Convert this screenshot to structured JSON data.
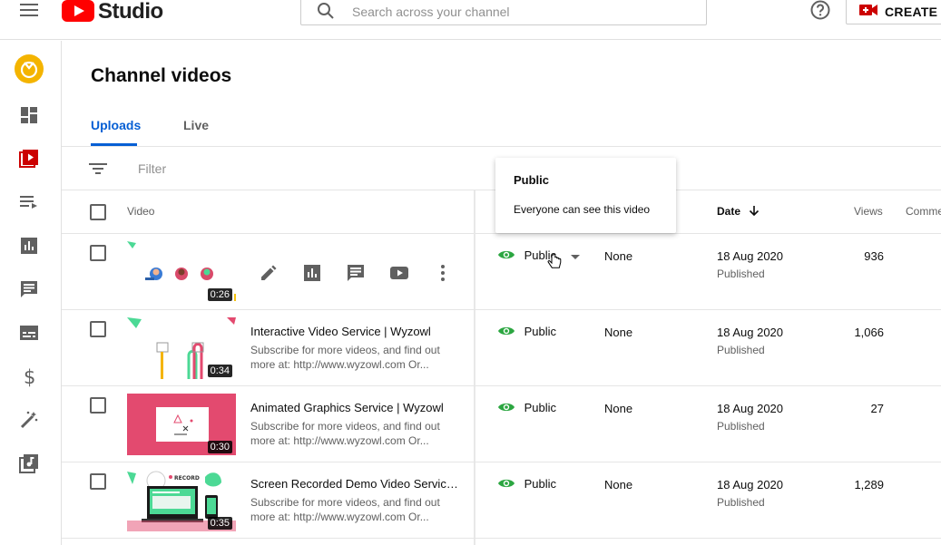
{
  "app": {
    "brand": "Studio"
  },
  "search": {
    "placeholder": "Search across your channel"
  },
  "header": {
    "create_label": "CREATE"
  },
  "page": {
    "title": "Channel videos"
  },
  "tabs": [
    {
      "label": "Uploads",
      "active": true
    },
    {
      "label": "Live",
      "active": false
    }
  ],
  "filter": {
    "placeholder": "Filter"
  },
  "columns": {
    "video": "Video",
    "date": "Date",
    "views": "Views",
    "comments": "Comme"
  },
  "popup": {
    "title": "Public",
    "description": "Everyone can see this video"
  },
  "videos": [
    {
      "title": "",
      "description": "",
      "duration": "0:26",
      "visibility": "Public",
      "restrictions": "None",
      "date": "18 Aug 2020",
      "status": "Published",
      "views": "936"
    },
    {
      "title": "Interactive Video Service | Wyzowl",
      "description": "Subscribe for more videos, and find out more at: http://www.wyzowl.com Or...",
      "duration": "0:34",
      "visibility": "Public",
      "restrictions": "None",
      "date": "18 Aug 2020",
      "status": "Published",
      "views": "1,066"
    },
    {
      "title": "Animated Graphics Service | Wyzowl",
      "description": "Subscribe for more videos, and find out more at: http://www.wyzowl.com Or...",
      "duration": "0:30",
      "visibility": "Public",
      "restrictions": "None",
      "date": "18 Aug 2020",
      "status": "Published",
      "views": "27"
    },
    {
      "title": "Screen Recorded Demo Video Service ...",
      "description": "Subscribe for more videos, and find out more at: http://www.wyzowl.com Or...",
      "duration": "0:35",
      "visibility": "Public",
      "restrictions": "None",
      "date": "18 Aug 2020",
      "status": "Published",
      "views": "1,289"
    }
  ],
  "thumb_texts": {
    "record": "RECORD"
  },
  "colors": {
    "accent": "#065fd4",
    "brand_red": "#ff0000",
    "eye_green": "#2ba640",
    "create_red": "#cc0000",
    "avatar": "#f4b400",
    "thumb_pink": "#e34a6f"
  },
  "icons": {
    "menu": "menu-icon",
    "search": "search-icon",
    "help": "help-icon",
    "create": "video-camera-icon",
    "sidebar": [
      "dashboard-icon",
      "content-icon",
      "playlists-icon",
      "analytics-icon",
      "comments-icon",
      "subtitles-icon",
      "monetization-icon",
      "customization-icon",
      "audio-library-icon"
    ],
    "row_actions": [
      "pencil-icon",
      "analytics-icon",
      "comments-icon",
      "youtube-icon",
      "more-vert-icon"
    ]
  }
}
